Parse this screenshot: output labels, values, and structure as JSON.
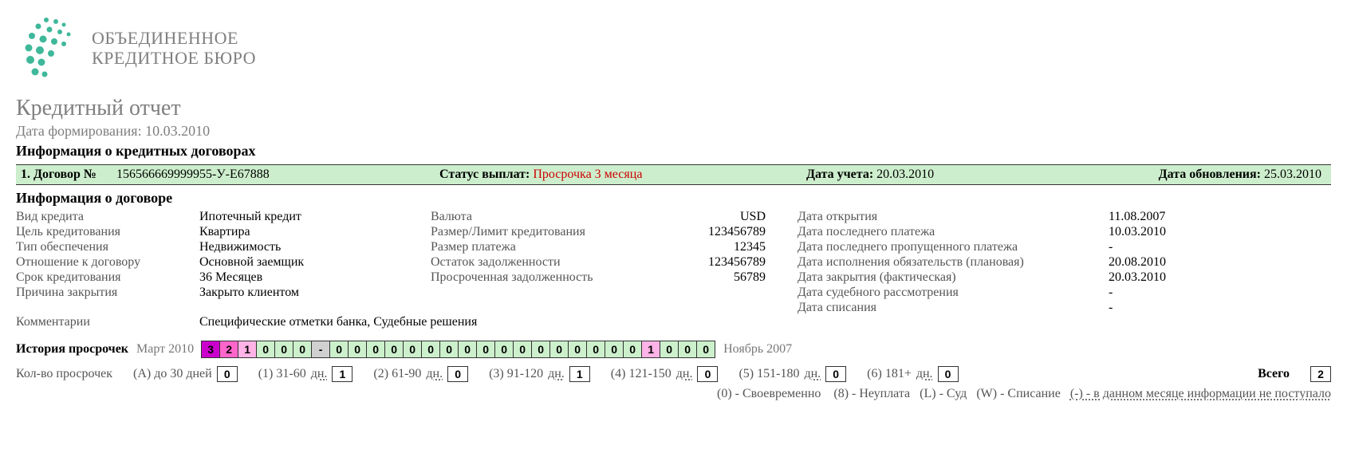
{
  "brand": {
    "line1": "ОБЪЕДИНЕННОЕ",
    "line2": "КРЕДИТНОЕ БЮРО"
  },
  "report": {
    "title": "Кредитный отчет",
    "date_label": "Дата формирования:",
    "date_value": "10.03.2010",
    "section_title": "Информация о кредитных договорах"
  },
  "greenbar": {
    "contract_no_label": "1.  Договор №",
    "contract_no": "156566669999955-У-Е67888",
    "status_label": "Статус выплат:",
    "status_value": "Просрочка 3 месяца",
    "record_date_label": "Дата учета:",
    "record_date": "20.03.2010",
    "update_date_label": "Дата обновления:",
    "update_date": "25.03.2010"
  },
  "contract_title": "Информация о договоре",
  "left_keys": {
    "credit_type": "Вид кредита",
    "purpose": "Цель кредитования",
    "collateral": "Тип обеспечения",
    "relation": "Отношение к договору",
    "term": "Срок кредитования",
    "close_reason": "Причина закрытия",
    "comments": "Комментарии"
  },
  "left_vals": {
    "credit_type": "Ипотечный кредит",
    "purpose": "Квартира",
    "collateral": "Недвижимость",
    "relation": "Основной заемщик",
    "term": "36 Месяцев",
    "close_reason": "Закрыто клиентом",
    "comments": "Специфические отметки банка, Судебные решения"
  },
  "mid_keys": {
    "currency": "Валюта",
    "limit": "Размер/Лимит кредитования",
    "payment": "Размер платежа",
    "balance": "Остаток задолженности",
    "overdue": "Просроченная задолженность"
  },
  "mid_vals": {
    "currency": "USD",
    "limit": "123456789",
    "payment": "12345",
    "balance": "123456789",
    "overdue": "56789"
  },
  "right_keys": {
    "open_date": "Дата открытия",
    "last_pay": "Дата последнего платежа",
    "last_missed": "Дата последнего пропущенного платежа",
    "planned": "Дата исполнения обязательств (плановая)",
    "closed": "Дата закрытия (фактическая)",
    "court": "Дата судебного рассмотрения",
    "writeoff": "Дата списания"
  },
  "right_vals": {
    "open_date": "11.08.2007",
    "last_pay": "10.03.2010",
    "last_missed": "-",
    "planned": "20.08.2010",
    "closed": "20.03.2010",
    "court": "-",
    "writeoff": "-"
  },
  "history": {
    "label": "История просрочек",
    "start": "Март 2010",
    "end": "Ноябрь 2007",
    "cells": [
      "3",
      "2",
      "1",
      "0",
      "0",
      "0",
      "-",
      "0",
      "0",
      "0",
      "0",
      "0",
      "0",
      "0",
      "0",
      "0",
      "0",
      "0",
      "0",
      "0",
      "0",
      "0",
      "0",
      "0",
      "1",
      "0",
      "0",
      "0"
    ]
  },
  "counts": {
    "label": "Кол-во просрочек",
    "g0": "(А) до 30 дней",
    "v0": "0",
    "g1": "(1) 31-60",
    "v1": "1",
    "g2": "(2) 61-90",
    "v2": "0",
    "g3": "(3) 91-120",
    "v3": "1",
    "g4": "(4) 121-150",
    "v4": "0",
    "g5": "(5) 151-180",
    "v5": "0",
    "g6": "(6) 181+",
    "v6": "0",
    "days_suffix": "дн.",
    "total_label": "Всего",
    "total_value": "2"
  },
  "legend": {
    "p0": "(0) - Своевременно",
    "p8": "(8) - Неуплата",
    "pL": "(L) - Суд",
    "pW": "(W) - Списание",
    "pdash": "(-) - в данном месяце информации не поступало"
  }
}
